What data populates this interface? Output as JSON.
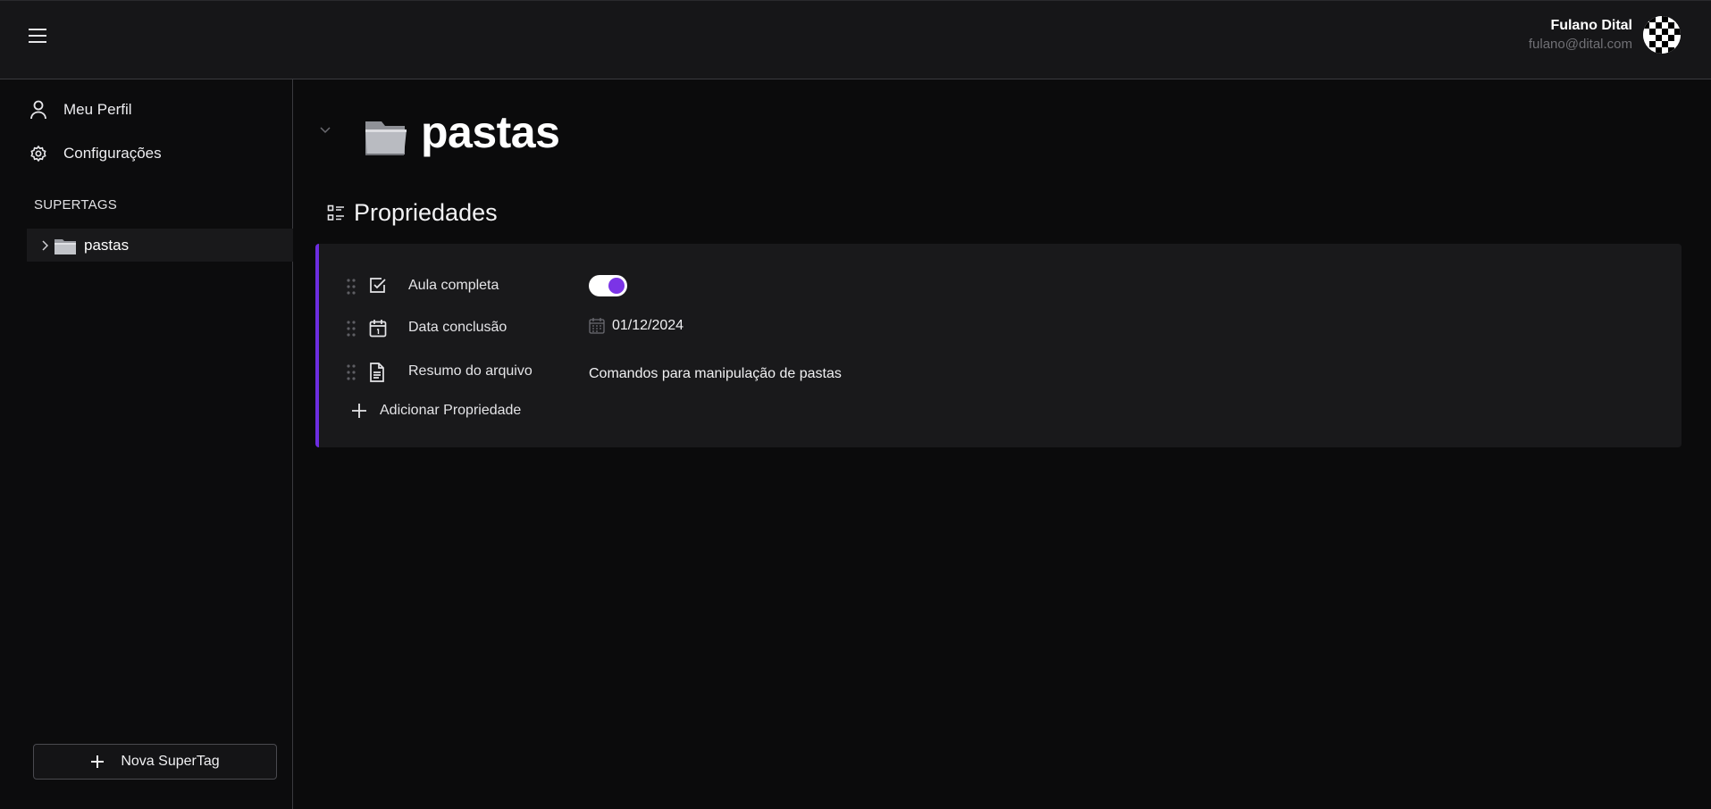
{
  "header": {
    "menu_icon": "hamburger-icon",
    "user": {
      "name": "Fulano Dital",
      "email": "fulano@dital.com"
    }
  },
  "sidebar": {
    "links": [
      {
        "label": "Meu Perfil",
        "icon": "user-icon"
      },
      {
        "label": "Configurações",
        "icon": "gear-icon"
      }
    ],
    "section_label": "SUPERTAGS",
    "tags": [
      {
        "label": "pastas",
        "icon": "folder-icon"
      }
    ],
    "new_tag_label": "Nova SuperTag"
  },
  "main": {
    "title": "pastas",
    "properties_heading": "Propriedades",
    "properties": [
      {
        "name": "Aula completa",
        "icon": "checkbox-icon",
        "type": "toggle",
        "value": true
      },
      {
        "name": "Data conclusão",
        "icon": "calendar-icon",
        "type": "date",
        "value": "01/12/2024"
      },
      {
        "name": "Resumo do arquivo",
        "icon": "document-icon",
        "type": "text",
        "value": "Comandos para manipulação de pastas"
      }
    ],
    "add_property_label": "Adicionar Propriedade"
  },
  "colors": {
    "accent": "#6d2de0",
    "toggle_knob": "#7b34e6",
    "background": "#0b0b0c",
    "card": "#19191b"
  }
}
